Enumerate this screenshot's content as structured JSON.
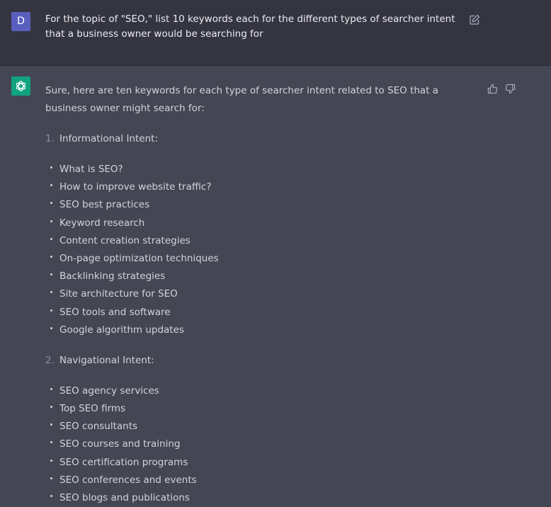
{
  "user_message": {
    "avatar_letter": "D",
    "avatar_color": "#5a5fbf",
    "text": "For the topic of \"SEO,\" list 10 keywords each for the different types of searcher intent that a business owner would be searching for",
    "edit_icon": "edit-icon"
  },
  "assistant_message": {
    "avatar_icon": "openai-logo-icon",
    "avatar_color": "#10a37f",
    "intro": "Sure, here are ten keywords for each type of searcher intent related to SEO that a business owner might search for:",
    "feedback": {
      "thumbs_up_icon": "thumbs-up-icon",
      "thumbs_down_icon": "thumbs-down-icon"
    },
    "sections": [
      {
        "number": "1.",
        "title": "Informational Intent:",
        "keywords": [
          "What is SEO?",
          "How to improve website traffic?",
          "SEO best practices",
          "Keyword research",
          "Content creation strategies",
          "On-page optimization techniques",
          "Backlinking strategies",
          "Site architecture for SEO",
          "SEO tools and software",
          "Google algorithm updates"
        ]
      },
      {
        "number": "2.",
        "title": "Navigational Intent:",
        "keywords": [
          "SEO agency services",
          "Top SEO firms",
          "SEO consultants",
          "SEO courses and training",
          "SEO certification programs",
          "SEO conferences and events",
          "SEO blogs and publications"
        ]
      }
    ]
  }
}
